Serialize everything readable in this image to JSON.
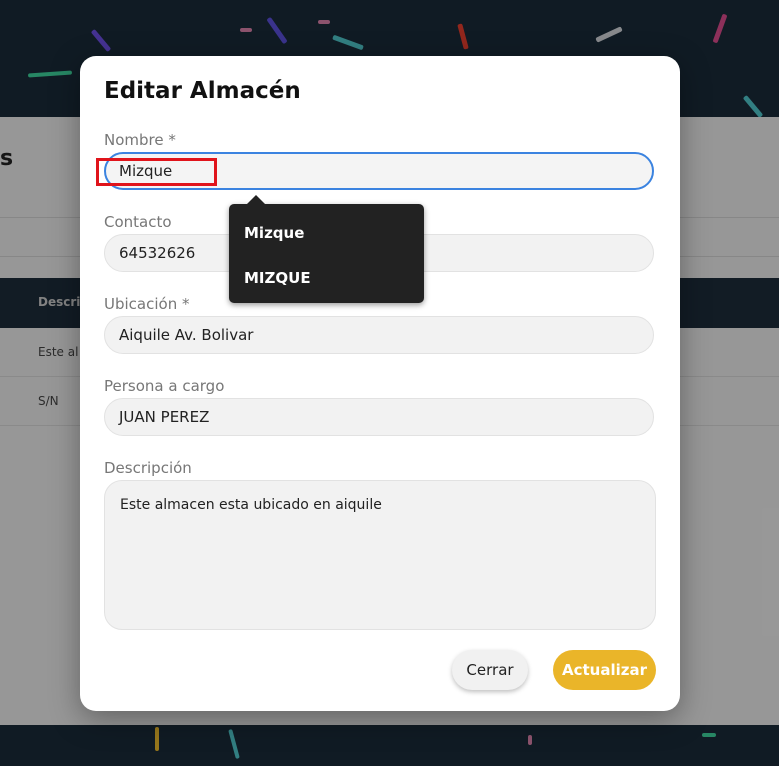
{
  "background": {
    "page_title_fragment": "s",
    "table_header_fragment": "Descrip",
    "rows": [
      "Este al",
      "S/N"
    ]
  },
  "modal": {
    "title": "Editar Almacén",
    "fields": {
      "nombre": {
        "label": "Nombre *",
        "value": "Mizque"
      },
      "contacto": {
        "label": "Contacto",
        "value": "64532626"
      },
      "ubicacion": {
        "label": "Ubicación *",
        "value": "Aiquile Av. Bolivar"
      },
      "persona": {
        "label": "Persona a cargo",
        "value": "JUAN PEREZ"
      },
      "descripcion": {
        "label": "Descripción",
        "value": "Este almacen esta ubicado en aiquile"
      }
    },
    "autocomplete": [
      "Mizque",
      "MIZQUE"
    ],
    "buttons": {
      "close": "Cerrar",
      "update": "Actualizar"
    }
  },
  "colors": {
    "accent": "#eab529",
    "focus": "#3b83e0",
    "highlight": "#e0141b",
    "header": "#1a2a38"
  }
}
